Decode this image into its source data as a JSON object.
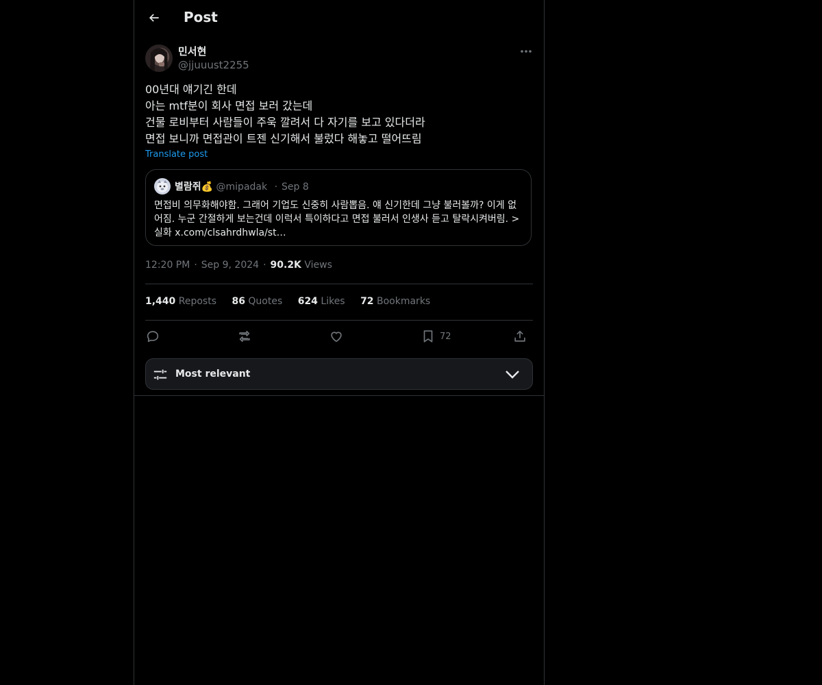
{
  "header": {
    "title": "Post"
  },
  "author": {
    "display_name": "민서현",
    "handle": "@jjuuust2255"
  },
  "post": {
    "lines": [
      "00년대 얘기긴 한데",
      "아는 mtf분이 회사 면접 보러 갔는데",
      "건물 로비부터 사람들이 주욱 깔려서 다 자기를 보고 있다더라",
      "면접 보니까 면접관이 트젠 신기해서 불렀다 해놓고 떨어뜨림"
    ],
    "translate_label": "Translate post"
  },
  "quote": {
    "display_name": "별람쥐💰",
    "handle": "@mipadak",
    "separator": "·",
    "date": "Sep 8",
    "text": "면접비 의무화해야함. 그래어 기업도 신중히 사람뽑음. 얘 신기한데 그냥 불러볼까? 이게 없어짐. 누군 간절하게 보는건데 이럭서 특이하다고 면접 불러서 인생사 듣고 탈락시켜버림. > 실화 x.com/clsahrdhwla/st…"
  },
  "meta": {
    "time": "12:20 PM",
    "date": "Sep 9, 2024",
    "separator": "·",
    "views_count": "90.2K",
    "views_label": "Views"
  },
  "stats": [
    {
      "count": "1,440",
      "label": "Reposts"
    },
    {
      "count": "86",
      "label": "Quotes"
    },
    {
      "count": "624",
      "label": "Likes"
    },
    {
      "count": "72",
      "label": "Bookmarks"
    }
  ],
  "actions": {
    "reply_icon": "reply-icon",
    "repost_icon": "repost-icon",
    "like_icon": "heart-icon",
    "bookmark_icon": "bookmark-icon",
    "bookmark_count": "72",
    "share_icon": "share-icon"
  },
  "replies_sort": {
    "label": "Most relevant"
  },
  "colors": {
    "background": "#000000",
    "text": "#e7e9ea",
    "muted": "#71767b",
    "link": "#1d9bf0",
    "border": "#2f3336"
  }
}
